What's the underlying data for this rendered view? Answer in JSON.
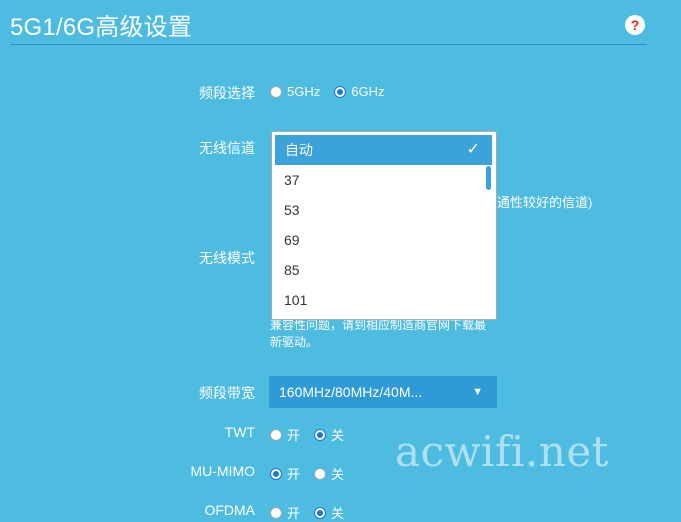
{
  "header": {
    "title": "5G1/6G高级设置",
    "help_symbol": "?"
  },
  "band_select": {
    "label": "频段选择",
    "options": [
      "5GHz",
      "6GHz"
    ],
    "selected": "6GHz"
  },
  "channel": {
    "label": "无线信道",
    "selected": "自动",
    "options": [
      "37",
      "53",
      "69",
      "85",
      "101"
    ],
    "hint_partial": "通性较好的信道)"
  },
  "mode": {
    "label": "无线模式",
    "note_line1": "兼容性问题，请到相应制造商官网下载最",
    "note_line2": "新驱动。"
  },
  "bandwidth": {
    "label": "频段带宽",
    "value": "160MHz/80MHz/40M..."
  },
  "twt": {
    "label": "TWT",
    "on": "开",
    "off": "关",
    "selected": "off"
  },
  "mumimo": {
    "label": "MU-MIMO",
    "on": "开",
    "off": "关",
    "selected": "on"
  },
  "ofdma": {
    "label": "OFDMA",
    "on": "开",
    "off": "关",
    "selected": "off"
  },
  "watermark": "acwifi.net"
}
